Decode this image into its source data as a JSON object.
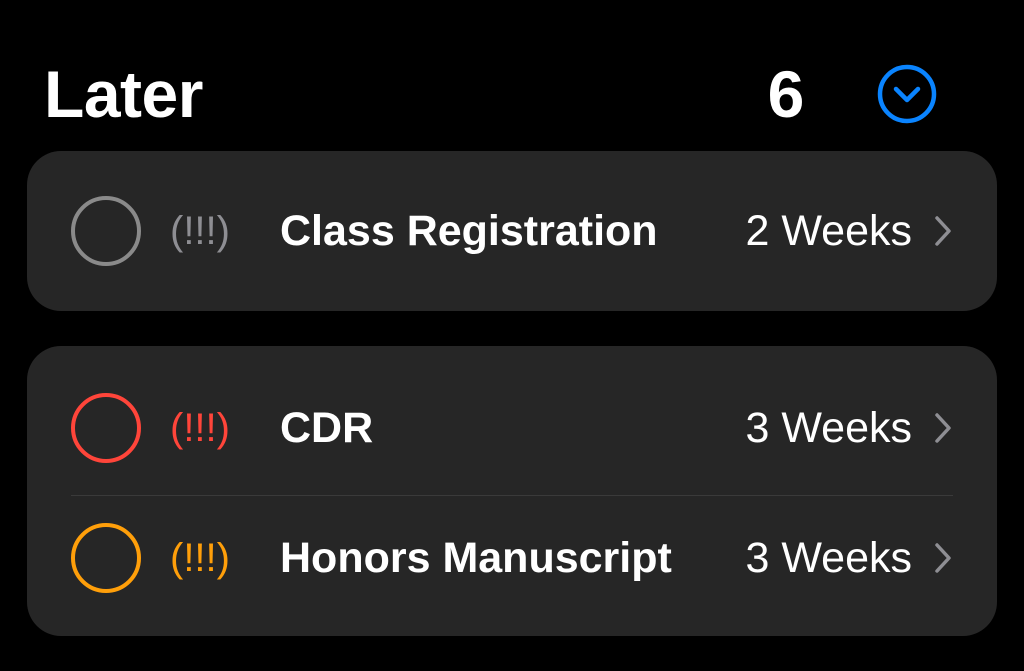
{
  "header": {
    "title": "Later",
    "count": "6",
    "collapse_icon": "chevron-down-circle-icon",
    "accent_color": "#0a84ff"
  },
  "groups": [
    {
      "items": [
        {
          "priority": "(!!!)",
          "title": "Class Registration",
          "due": "2 Weeks",
          "circle_color": "#8a8a8a",
          "priority_color": "#8e8e93"
        }
      ]
    },
    {
      "items": [
        {
          "priority": "(!!!)",
          "title": "CDR",
          "due": "3 Weeks",
          "circle_color": "#ff453a",
          "priority_color": "#ff453a"
        },
        {
          "priority": "(!!!)",
          "title": "Honors Manuscript",
          "due": "3 Weeks",
          "circle_color": "#ff9f0a",
          "priority_color": "#ff9f0a"
        }
      ]
    }
  ],
  "icons": {
    "completion": "circle-icon",
    "disclosure": "chevron-right-icon"
  }
}
